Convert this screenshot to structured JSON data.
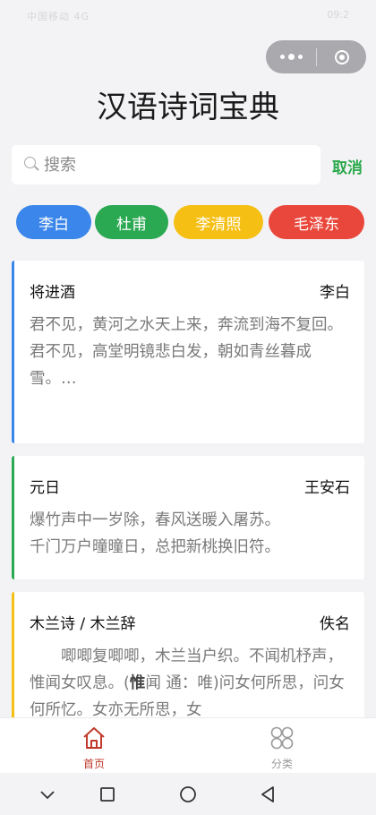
{
  "app": {
    "title": "汉语诗词宝典"
  },
  "status_bar": {
    "left": "中国移动 4G",
    "right": "09:2"
  },
  "search": {
    "placeholder": "搜索",
    "cancel_label": "取消"
  },
  "tags": [
    {
      "label": "李白",
      "color": "#3b86ea"
    },
    {
      "label": "杜甫",
      "color": "#2ba852"
    },
    {
      "label": "李清照",
      "color": "#f5bf13"
    },
    {
      "label": "毛泽东",
      "color": "#e9473b"
    }
  ],
  "poems": [
    {
      "title": "将进酒",
      "author": "李白",
      "accent": "#3b86ea",
      "lines": [
        "君不见，黄河之水天上来，奔流到海不复回。",
        "君不见，高堂明镜悲白发，朝如青丝暮成雪。…"
      ]
    },
    {
      "title": "元日",
      "author": "王安石",
      "accent": "#2ba852",
      "lines": [
        "爆竹声中一岁除，春风送暖入屠苏。",
        "千门万户曈曈日，总把新桃换旧符。"
      ]
    },
    {
      "title": "木兰诗 / 木兰辞",
      "author": "佚名",
      "accent": "#f5bf13",
      "line_prefix": "　　唧唧复唧唧，木兰当户织。不闻机杼声，惟闻女叹息。(",
      "line_bold": "惟",
      "line_suffix": "闻 通：唯)问女何所思，问女何所忆。女亦无所思，女"
    }
  ],
  "tabbar": {
    "home_label": "首页",
    "category_label": "分类",
    "active_color": "#c0392b",
    "inactive_color": "#9a9a9a"
  }
}
